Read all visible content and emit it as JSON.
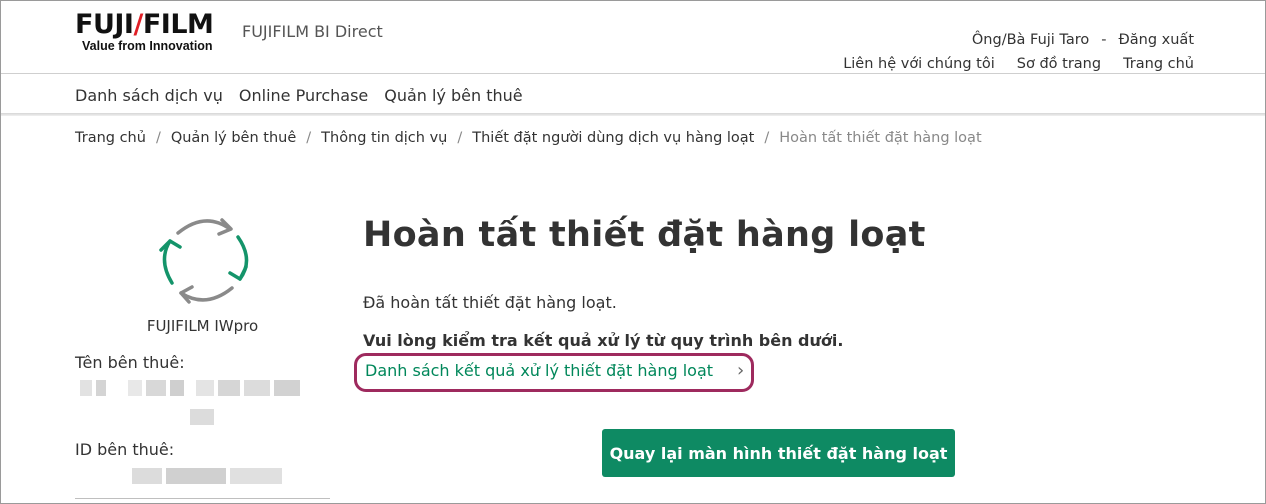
{
  "brand": {
    "logo_part1": "FUJI",
    "logo_accent": "/",
    "logo_part2": "FILM",
    "tagline": "Value from Innovation",
    "site_name": "FUJIFILM BI Direct",
    "accent_color": "#e01f26"
  },
  "user_menu": {
    "user_name": "Ông/Bà Fuji Taro",
    "separator": "-",
    "logout": "Đăng xuất",
    "contact": "Liên hệ với chúng tôi",
    "sitemap": "Sơ đồ trang",
    "home": "Trang chủ"
  },
  "nav": {
    "items": [
      "Danh sách dịch vụ",
      "Online Purchase",
      "Quản lý bên thuê"
    ]
  },
  "breadcrumb": {
    "items": [
      "Trang chủ",
      "Quản lý bên thuê",
      "Thông tin dịch vụ",
      "Thiết đặt người dùng dịch vụ hàng loạt"
    ],
    "current": "Hoàn tất thiết đặt hàng loạt"
  },
  "sidebar": {
    "product_icon": "sync-arrows-icon",
    "product_name": "FUJIFILM IWpro",
    "tenant_name_label": "Tên bên thuê:",
    "tenant_id_label": "ID bên thuê:"
  },
  "main": {
    "title": "Hoàn tất thiết đặt hàng loạt",
    "message": "Đã hoàn tất thiết đặt hàng loạt.",
    "instruction": "Vui lòng kiểm tra kết quả xử lý từ quy trình bên dưới.",
    "result_link": "Danh sách kết quả xử lý thiết đặt hàng loạt",
    "back_button": "Quay lại màn hình thiết đặt hàng loạt",
    "button_color": "#0e8a63",
    "link_color": "#00875a",
    "highlight_color": "#9e2a5e"
  }
}
